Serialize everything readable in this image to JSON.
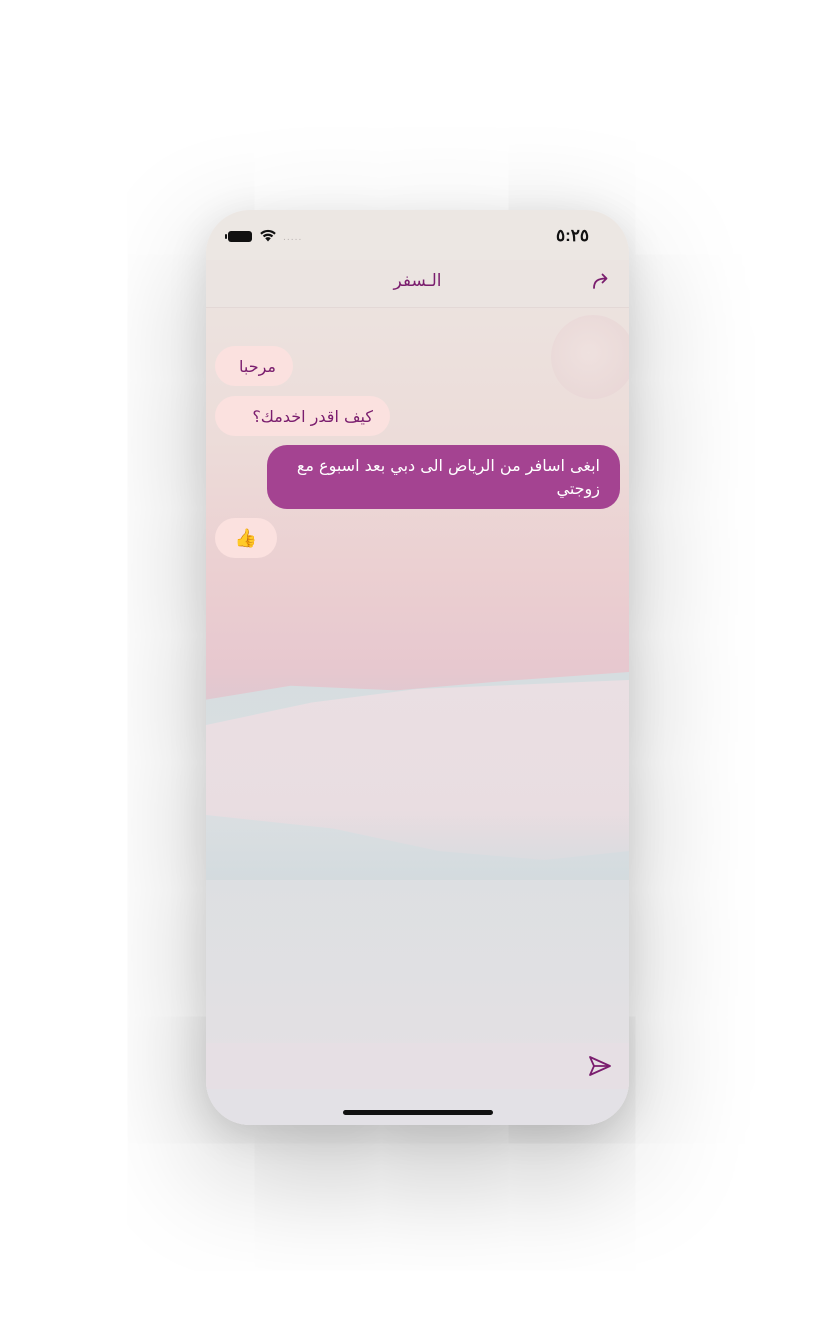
{
  "status_bar": {
    "time": "٥:٢٥",
    "battery_icon": "battery-icon",
    "wifi_icon": "wifi-icon",
    "signal_dots": "....."
  },
  "nav": {
    "title": "الـسفر",
    "share_icon": "share-icon"
  },
  "messages": [
    {
      "sender": "bot",
      "text": "مرحبا"
    },
    {
      "sender": "bot",
      "text": "كيف اقدر اخدمك؟"
    },
    {
      "sender": "user",
      "text": "ابغى اسافر من الرياض الى دبي بعد اسبوع مع زوجتي"
    },
    {
      "sender": "bot",
      "text": "👍"
    }
  ],
  "composer": {
    "placeholder": "",
    "send_icon": "send-icon"
  },
  "colors": {
    "accent": "#7a1d6e",
    "user_bubble": "#a44391",
    "bot_bubble": "#fbe1df"
  }
}
